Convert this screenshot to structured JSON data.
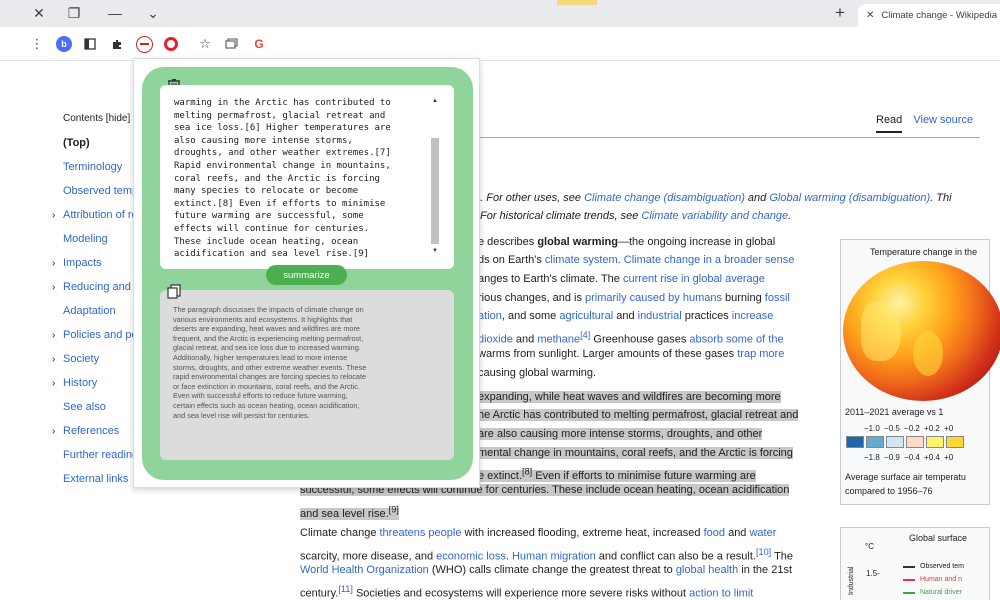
{
  "browser": {
    "tab_title": "Climate change - Wikipedia",
    "tab_close": "✕",
    "controls": [
      "✕",
      "❐",
      "—",
      "⌄"
    ],
    "new_tab": "+",
    "extensions": [
      {
        "icon": "profile-b-icon",
        "label": "b"
      },
      {
        "icon": "reader-icon"
      },
      {
        "icon": "puzzle-icon"
      },
      {
        "icon": "summarizer-extension-icon"
      },
      {
        "icon": "opera-icon"
      },
      {
        "icon": "bookmark-star-icon"
      },
      {
        "icon": "tab-search-icon"
      },
      {
        "icon": "google-icon",
        "label": "G"
      }
    ]
  },
  "popup": {
    "input_text": "warming in the Arctic has contributed to\nmelting permafrost, glacial retreat and\nsea ice loss.[6] Higher temperatures are\nalso causing more intense storms,\ndroughts, and other weather extremes.[7]\nRapid environmental change in mountains,\ncoral reefs, and the Arctic is forcing\nmany species to relocate or become\nextinct.[8] Even if efforts to minimise\nfuture warming are successful, some\neffects will continue for centuries.\nThese include ocean heating, ocean\nacidification and sea level rise.[9]",
    "summarize_label": "summarize",
    "summary_text": "The paragraph discusses the impacts of climate change on\nvarious environments and ecosystems. It highlights that\ndeserts are expanding, heat waves and wildfires are more\nfrequent, and the Arctic is experiencing melting permafrost,\nglacial retreat, and sea ice loss due to increased warming.\nAdditionally, higher temperatures lead to more intense\nstorms, droughts, and other extreme weather events. These\nrapid environmental changes are forcing species to relocate\nor face extinction in mountains, coral reefs, and the Arctic.\nEven with successful efforts to reduce future warming,\ncertain effects such as ocean heating, ocean acidification,\nand sea level rise will persist for centuries.",
    "colors": {
      "panel": "#8fd49a",
      "button": "#4caf50"
    }
  },
  "wiki": {
    "toc_title": "Contents [hide]",
    "toc": [
      {
        "label": "(Top)",
        "chevron": false
      },
      {
        "label": "Terminology",
        "chevron": false
      },
      {
        "label": "Observed temperature rise",
        "chevron": false
      },
      {
        "label": "Attribution of recent temperature rise",
        "chevron": true
      },
      {
        "label": "Modeling",
        "chevron": false
      },
      {
        "label": "Impacts",
        "chevron": true
      },
      {
        "label": "Reducing and recapturing emissions",
        "chevron": true
      },
      {
        "label": "Adaptation",
        "chevron": false
      },
      {
        "label": "Policies and politics",
        "chevron": true
      },
      {
        "label": "Society",
        "chevron": true
      },
      {
        "label": "History",
        "chevron": true
      },
      {
        "label": "See also",
        "chevron": false
      },
      {
        "label": "References",
        "chevron": true
      },
      {
        "label": "Further reading",
        "chevron": false
      },
      {
        "label": "External links",
        "chevron": false
      }
    ],
    "tab_read": "Read",
    "tab_view_source": "View source",
    "hatnote1_a": "n. For other uses, see ",
    "hatnote1_link1": "Climate change (disambiguation)",
    "hatnote1_b": " and ",
    "hatnote1_link2": "Global warming (disambiguation)",
    "hatnote1_c": ". Thi",
    "hatnote2_a": "For historical climate trends, see ",
    "hatnote2_link": "Climate variability and change",
    "hatnote2_b": ".",
    "p1_l1_a": "e describes ",
    "p1_l1_b": "global warming",
    "p1_l1_c": "—the ongoing increase in global",
    "p1_l2_a": "ds on Earth's ",
    "p1_l2_link1": "climate system",
    "p1_l2_b": ". ",
    "p1_l2_link2": "Climate change in a broader sense",
    "p1_l3_a": "anges to Earth's climate. The ",
    "p1_l3_link": "current rise in global average",
    "p1_l4_a": "rious changes, and is ",
    "p1_l4_link1": "primarily caused by humans",
    "p1_l4_b": " burning ",
    "p1_l4_link2": "fossil",
    "p1_l5_link1": "ation",
    "p1_l5_a": ", and some ",
    "p1_l5_link2": "agricultural",
    "p1_l5_b": " and ",
    "p1_l5_link3": "industrial",
    "p1_l5_c": " practices ",
    "p1_l5_link4": "increase",
    "p1_l6_link1": "dioxide",
    "p1_l6_a": " and ",
    "p1_l6_link2": "methane",
    "p1_l6_sup": "[4]",
    "p1_l6_b": " Greenhouse gases ",
    "p1_l6_link3": "absorb some of the",
    "p1_l7_a": "warms from sunlight. Larger amounts of these gases ",
    "p1_l7_link": "trap more",
    "p1_l8": "causing global warming.",
    "p2_l1": "expanding, while heat waves and wildfires are becoming more",
    "p2_l2": "he Arctic has contributed to melting permafrost, glacial retreat and",
    "p2_l3": "are also causing more intense storms, droughts, and other",
    "p2_l4": "mental change in mountains, coral reefs, and the Arctic is forcing",
    "p2_l5_a": "e extinct.",
    "p2_l5_sup": "[8]",
    "p2_l5_b": " Even if efforts to minimise future warming are",
    "p2_l6": "successful, some effects will continue for centuries. These include ocean heating, ocean acidification",
    "p2_l7_a": "and sea level rise.",
    "p2_l7_sup": "[9]",
    "p3_l1_a": "Climate change ",
    "p3_l1_link1": "threatens people",
    "p3_l1_b": " with increased flooding, extreme heat, increased ",
    "p3_l1_link2": "food",
    "p3_l1_c": " and ",
    "p3_l1_link3": "water",
    "p3_l2_a": "scarcity, more disease, and ",
    "p3_l2_link1": "economic loss",
    "p3_l2_b": ". ",
    "p3_l2_link2": "Human migration",
    "p3_l2_c": " and conflict can also be a result.",
    "p3_l2_sup": "[10]",
    "p3_l2_d": " The",
    "p3_l3_link1": "World Health Organization",
    "p3_l3_a": " (WHO) calls climate change the greatest threat to ",
    "p3_l3_link2": "global health",
    "p3_l3_b": " in the 21st",
    "p3_l4_a": "century.",
    "p3_l4_sup": "[11]",
    "p3_l4_b": " Societies and ecosystems will experience more severe risks without ",
    "p3_l4_link": "action to limit",
    "infobox": {
      "title": "Temperature change in the",
      "range": "2011–2021 average vs 1",
      "scale_top": "−1.0  −0.5  −0.2  +0.2  +0",
      "scale_bot": "−1.8  −0.9  −0.4  +0.4  +0",
      "scale_colors": [
        "#2166ac",
        "#67a9cf",
        "#d1e5f0",
        "#fddbc7",
        "#fff36b",
        "#fdd835"
      ],
      "caption1": "Average surface air temperatu",
      "caption2": "compared to 1956–76"
    },
    "chart": {
      "title": "Global surface",
      "unit": "°C",
      "tick": "1.5-",
      "ylabel": "Industrial",
      "legend": [
        {
          "label": "Observed tem",
          "color": "#333333"
        },
        {
          "label": "Human and n",
          "color": "#e53935"
        },
        {
          "label": "Natural driver",
          "color": "#43a047"
        }
      ]
    }
  }
}
